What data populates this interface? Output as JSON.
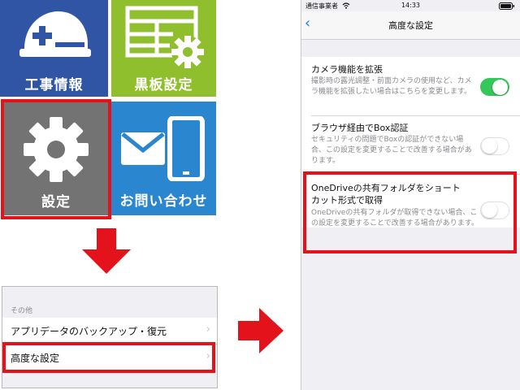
{
  "tiles": {
    "construction_info": "工事情報",
    "blackboard_settings": "黒板設定",
    "settings": "設定",
    "contact": "お問い合わせ"
  },
  "settings_list": {
    "section_header": "その他",
    "items": [
      {
        "label": "アプリデータのバックアップ・復元"
      },
      {
        "label": "高度な設定"
      }
    ]
  },
  "phone": {
    "status": {
      "carrier": "通信事業者",
      "time": "14:33"
    },
    "nav_title": "高度な設定",
    "options": [
      {
        "title": "カメラ機能を拡張",
        "description": "撮影時の露光調整・前面カメラの使用など、カメラ機能を拡張したい場合はこちらを変更します。",
        "enabled": true
      },
      {
        "title": "ブラウザ経由でBox認証",
        "description": "セキュリティの問題でBoxの認証ができない場合、この設定を変更することで改善する場合があります。",
        "enabled": false
      },
      {
        "title": "OneDriveの共有フォルダをショートカット形式で取得",
        "description": "OneDriveの共有フォルダが取得できない場合、この設定を変更することで改善する場合があります。",
        "enabled": false
      }
    ]
  },
  "colors": {
    "highlight": "#e3121b",
    "toggle_on": "#34c759",
    "link": "#1a7cf2"
  }
}
